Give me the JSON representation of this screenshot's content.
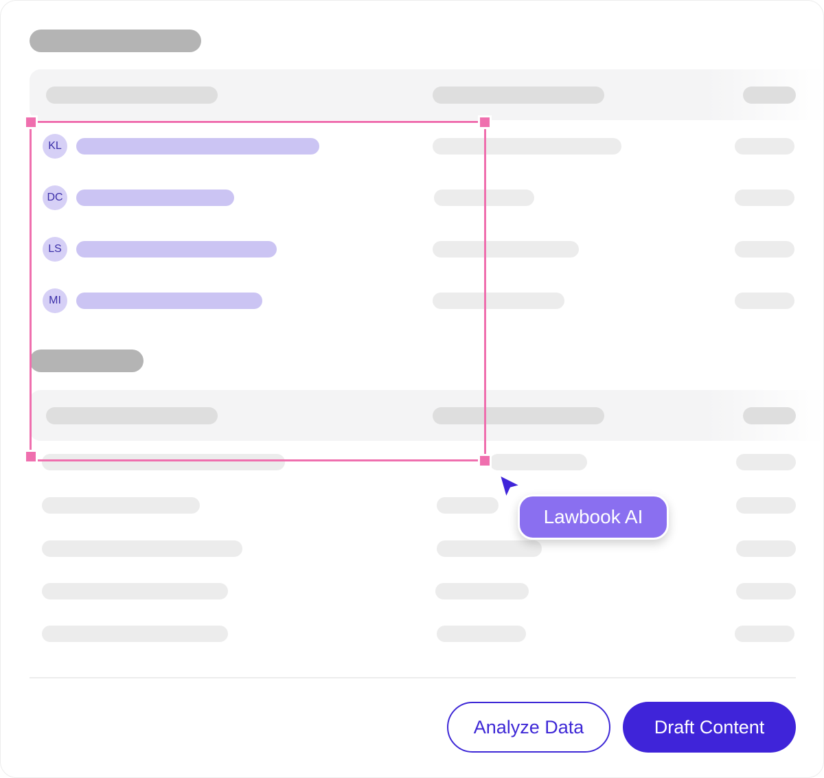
{
  "table1": {
    "rows": [
      {
        "initials": "KL"
      },
      {
        "initials": "DC"
      },
      {
        "initials": "LS"
      },
      {
        "initials": "MI"
      }
    ]
  },
  "selection": {
    "label": "Lawbook AI",
    "color": "#ef6fae"
  },
  "footer": {
    "analyze_label": "Analyze Data",
    "draft_label": "Draft Content"
  },
  "colors": {
    "accent": "#3f24d9",
    "avatar_bg": "#d6d0f6",
    "row_highlight": "#cbc4f3",
    "tag_bg": "#8a6ff0"
  }
}
